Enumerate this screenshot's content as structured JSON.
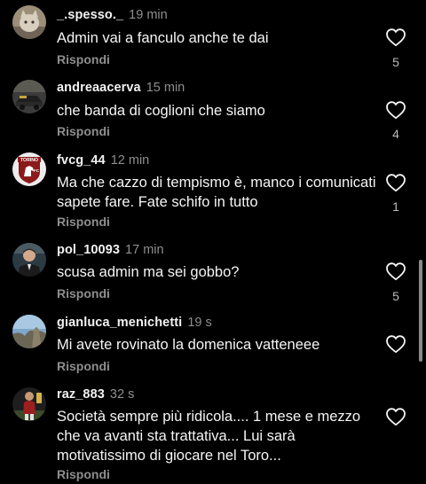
{
  "comments": [
    {
      "username": "_.spesso._",
      "time": "19 min",
      "text": "Admin vai a fanculo anche te dai",
      "reply_label": "Rispondi",
      "likes": "5",
      "avatar_icon": "cat-photo-avatar"
    },
    {
      "username": "andreaacerva",
      "time": "15 min",
      "text": "che banda di coglioni che siamo",
      "reply_label": "Rispondi",
      "likes": "4",
      "avatar_icon": "car-photo-avatar"
    },
    {
      "username": "fvcg_44",
      "time": "12 min",
      "text": "Ma che cazzo di tempismo è, manco i comunicati sapete fare. Fate schifo in tutto",
      "reply_label": "Rispondi",
      "likes": "1",
      "avatar_icon": "torino-fc-crest-avatar",
      "avatar_text": "TORINO"
    },
    {
      "username": "pol_10093",
      "time": "17 min",
      "text": "scusa admin ma sei gobbo?",
      "reply_label": "Rispondi",
      "likes": "5",
      "avatar_icon": "person-photo-avatar"
    },
    {
      "username": "gianluca_menichetti",
      "time": "19 s",
      "text": "Mi avete rovinato la domenica vatteneee",
      "reply_label": "Rispondi",
      "likes": "",
      "avatar_icon": "landscape-photo-avatar"
    },
    {
      "username": "raz_883",
      "time": "32 s",
      "text": "Società sempre più ridicola.... 1 mese e mezzo che va avanti sta trattativa... Lui sarà motivatissimo di giocare nel Toro...",
      "reply_label": "Rispondi",
      "likes": "",
      "avatar_icon": "player-photo-avatar"
    }
  ],
  "colors": {
    "background": "#000000",
    "primary_text": "#f5f5f5",
    "secondary_text": "#8e8e8e",
    "torino_maroon": "#8b1a1a"
  }
}
